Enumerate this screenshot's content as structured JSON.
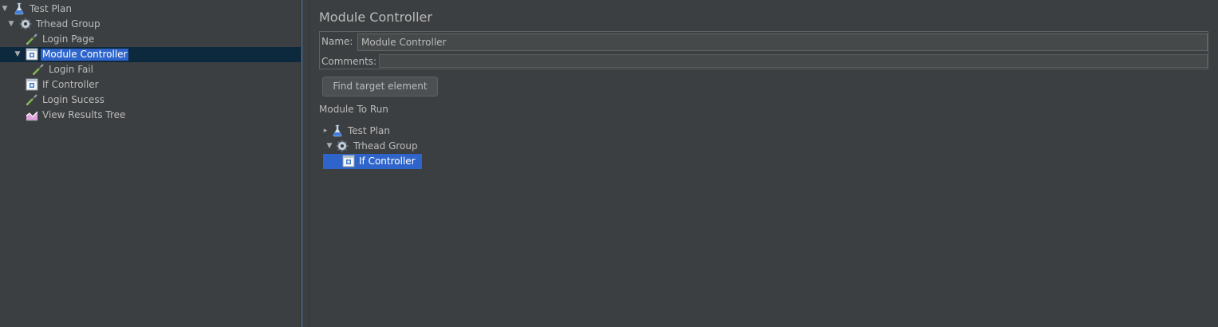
{
  "tree": {
    "items": [
      {
        "label": "Test Plan",
        "icon": "flask-icon"
      },
      {
        "label": "Trhead Group",
        "icon": "gear-icon"
      },
      {
        "label": "Login Page",
        "icon": "pipette-icon"
      },
      {
        "label": "Module Controller",
        "icon": "controller-icon"
      },
      {
        "label": "Login Fail",
        "icon": "pipette-icon"
      },
      {
        "label": "If Controller",
        "icon": "controller-icon"
      },
      {
        "label": "Login Sucess",
        "icon": "pipette-icon"
      },
      {
        "label": "View Results Tree",
        "icon": "chart-icon"
      }
    ],
    "selected": "Module Controller"
  },
  "panel": {
    "title": "Module Controller",
    "name_label": "Name:",
    "name_value": "Module Controller",
    "comments_label": "Comments:",
    "find_button": "Find target element",
    "module_to_run_label": "Module To Run"
  },
  "module_tree": {
    "items": [
      {
        "label": "Test Plan",
        "icon": "flask-icon"
      },
      {
        "label": "Trhead Group",
        "icon": "gear-icon"
      },
      {
        "label": "If Controller",
        "icon": "controller-icon"
      }
    ],
    "selected": "If Controller"
  },
  "colors": {
    "background": "#3c3f41",
    "selection": "#2f65ca",
    "selected_row": "#0d293e",
    "text": "#bbbbbb"
  }
}
